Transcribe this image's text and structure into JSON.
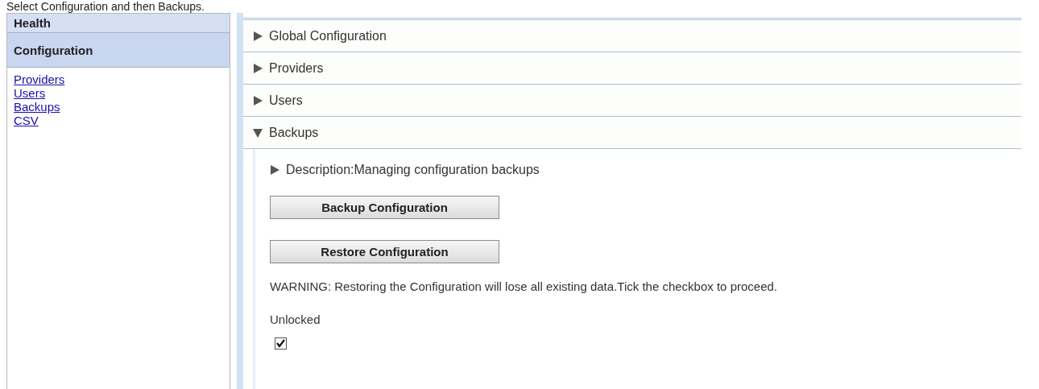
{
  "caption": "Select Configuration and then Backups.",
  "sidebar": {
    "sections": [
      {
        "label": "Health",
        "selected": false
      },
      {
        "label": "Configuration",
        "selected": true
      }
    ],
    "links": [
      "Providers",
      "Users",
      "Backups",
      "CSV"
    ]
  },
  "accordion": [
    {
      "label": "Global Configuration",
      "expanded": false
    },
    {
      "label": "Providers",
      "expanded": false
    },
    {
      "label": "Users",
      "expanded": false
    },
    {
      "label": "Backups",
      "expanded": true,
      "content": {
        "description": {
          "label": "Description:Managing configuration backups",
          "expanded": false
        },
        "buttons": [
          "Backup Configuration",
          "Restore Configuration"
        ],
        "warning": "WARNING: Restoring the Configuration will lose all existing data.Tick the checkbox to proceed.",
        "lock_label": "Unlocked",
        "checked": true
      }
    }
  ]
}
